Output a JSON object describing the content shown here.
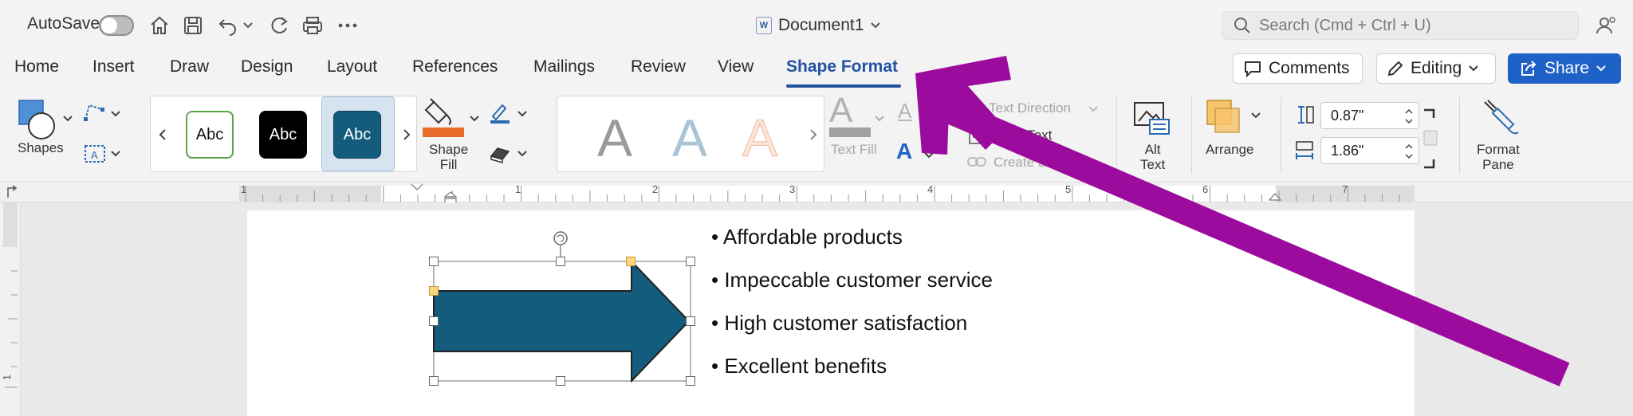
{
  "titlebar": {
    "autosave_label": "AutoSave",
    "doc_title": "Document1",
    "search_placeholder": "Search (Cmd + Ctrl + U)"
  },
  "tabs": [
    {
      "label": "Home"
    },
    {
      "label": "Insert"
    },
    {
      "label": "Draw"
    },
    {
      "label": "Design"
    },
    {
      "label": "Layout"
    },
    {
      "label": "References"
    },
    {
      "label": "Mailings"
    },
    {
      "label": "Review"
    },
    {
      "label": "View"
    },
    {
      "label": "Shape Format"
    }
  ],
  "actions": {
    "comments": "Comments",
    "editing": "Editing",
    "share": "Share"
  },
  "ribbon": {
    "shapes": "Shapes",
    "style_sample": "Abc",
    "shape_fill_1": "Shape",
    "shape_fill_2": "Fill",
    "wordart_letter": "A",
    "text_fill": "Text Fill",
    "text_direction": "Text Direction",
    "align_text": "Align Text",
    "create_link": "Create Link",
    "alt_text_1": "Alt",
    "alt_text_2": "Text",
    "arrange": "Arrange",
    "height_value": "0.87\"",
    "width_value": "1.86\"",
    "format_pane_1": "Format",
    "format_pane_2": "Pane"
  },
  "ruler": {
    "numbers": [
      "1",
      "1",
      "2",
      "3",
      "4",
      "5",
      "6",
      "7"
    ]
  },
  "vruler": {
    "number": "1"
  },
  "document": {
    "bullets": [
      "Affordable products",
      "Impeccable customer service",
      "High customer satisfaction",
      "Excellent benefits"
    ]
  },
  "colors": {
    "accent": "#2452a3",
    "share_button": "#1f62c7",
    "shape_fill": "#135c7e",
    "annotation_arrow": "#9b0c9e",
    "shape_fill_swatch": "#e86b2a"
  },
  "icons": [
    "home-icon",
    "save-icon",
    "undo-icon",
    "redo-icon",
    "print-icon",
    "more-icon",
    "search-icon",
    "user-icon"
  ]
}
